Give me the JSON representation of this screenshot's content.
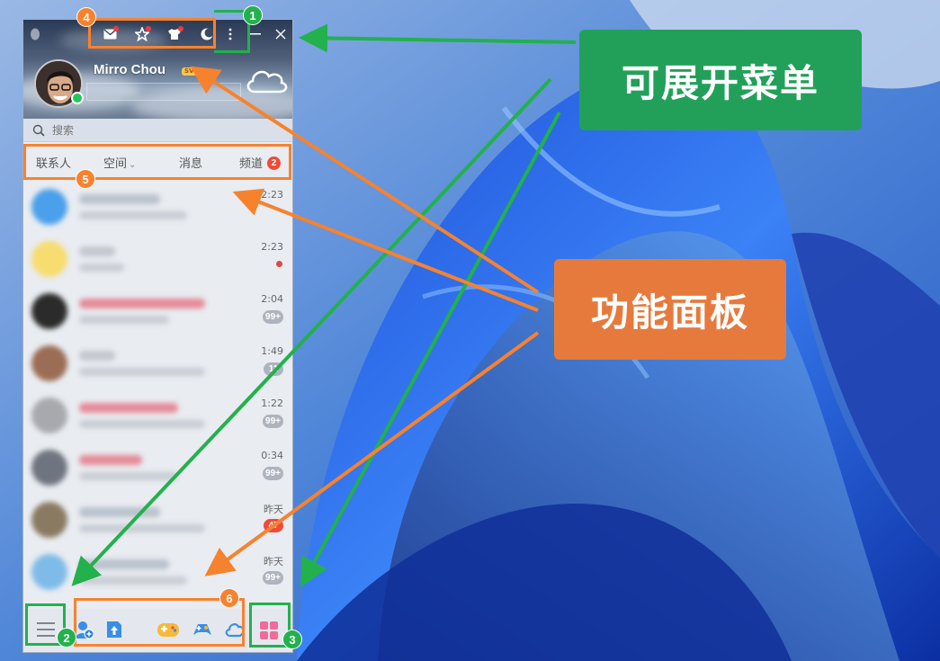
{
  "app": {
    "username": "Mirro Chou",
    "vip_badge": "SVIP",
    "search_placeholder": "搜索"
  },
  "tabs": [
    {
      "label": "联系人"
    },
    {
      "label": "空间"
    },
    {
      "label": "消息"
    },
    {
      "label": "频道",
      "badge": "2"
    }
  ],
  "conversations": [
    {
      "time": "2:23",
      "badge": ""
    },
    {
      "time": "2:23",
      "badge": "",
      "dot": true
    },
    {
      "time": "2:04",
      "badge": "99+"
    },
    {
      "time": "1:49",
      "badge": "11"
    },
    {
      "time": "1:22",
      "badge": "99+"
    },
    {
      "time": "0:34",
      "badge": "99+"
    },
    {
      "time": "昨天",
      "badge": "47"
    },
    {
      "time": "昨天",
      "badge": "99+"
    }
  ],
  "annotations": {
    "numbers": [
      "1",
      "2",
      "3",
      "4",
      "5",
      "6"
    ],
    "callout_menu": "可展开菜单",
    "callout_panel": "功能面板",
    "colors": {
      "green": "#22b14c",
      "orange": "#f7822e",
      "callout_green": "#22a05a",
      "callout_orange": "#e67a3c"
    }
  }
}
